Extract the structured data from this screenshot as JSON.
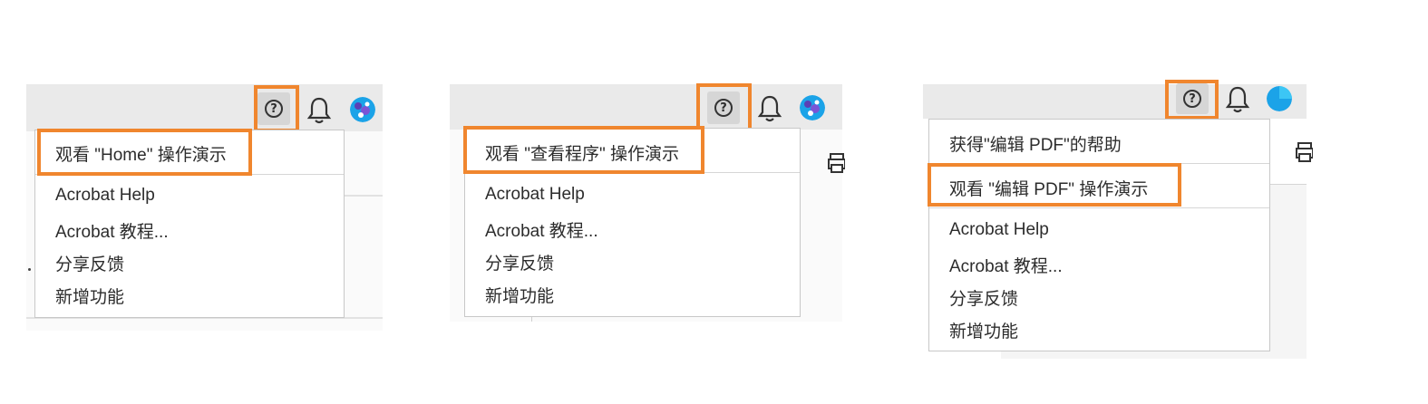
{
  "panels": [
    {
      "highlighted_item": "观看 \"Home\" 操作演示",
      "items": [
        "Acrobat Help",
        "Acrobat 教程...",
        "分享反馈",
        "新增功能"
      ]
    },
    {
      "highlighted_item": "观看 \"查看程序\" 操作演示",
      "items": [
        "Acrobat Help",
        "Acrobat 教程...",
        "分享反馈",
        "新增功能"
      ]
    },
    {
      "top_item": "获得\"编辑 PDF\"的帮助",
      "highlighted_item": "观看 \"编辑 PDF\" 操作演示",
      "items": [
        "Acrobat Help",
        "Acrobat 教程...",
        "分享反馈",
        "新增功能"
      ]
    }
  ],
  "icons": {
    "help": "question-circle-icon",
    "notifications": "bell-icon",
    "user": "avatar",
    "side": "print-icon",
    "help_glyph": "?"
  },
  "colors": {
    "highlight": "#f0862e",
    "toolbar": "#eaeaea",
    "help_button_bg": "#d6d6d6",
    "avatar_blue": "#1ba3e8"
  }
}
